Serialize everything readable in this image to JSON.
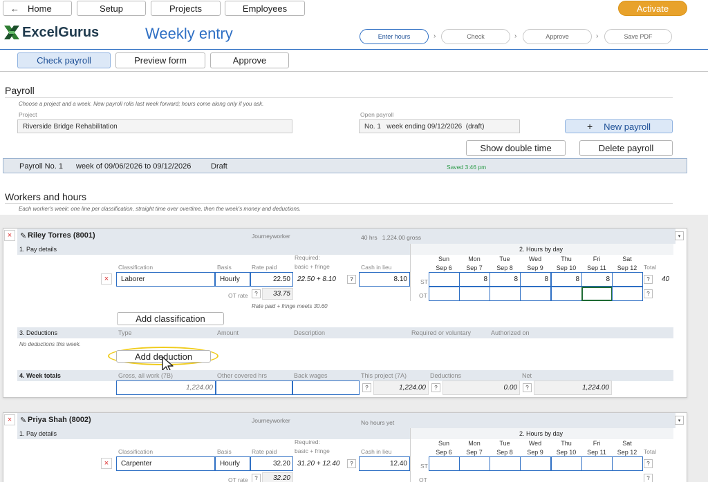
{
  "nav": {
    "home": "Home",
    "setup": "Setup",
    "projects": "Projects",
    "employees": "Employees",
    "activate": "Activate",
    "back_icon": "arrow-left-icon"
  },
  "brand": {
    "name": "ExcelGurus",
    "page_title": "Weekly entry"
  },
  "steps": [
    "Enter hours",
    "Check",
    "Approve",
    "Save PDF"
  ],
  "tabs": [
    "Check payroll",
    "Preview form",
    "Approve"
  ],
  "payroll": {
    "heading": "Payroll",
    "hint": "Choose a project and a week. New payroll rolls last week forward; hours come along only if you ask.",
    "project_label": "Project",
    "project_value": "Riverside Bridge Rehabilitation",
    "open_label": "Open payroll",
    "open_value": "No. 1   week ending 09/12/2026  (draft)",
    "new_payroll": "New payroll",
    "show_double": "Show double time",
    "delete_payroll": "Delete payroll"
  },
  "status": {
    "payroll_no": "Payroll No. 1",
    "week": "week of 09/06/2026 to 09/12/2026",
    "state": "Draft",
    "saved": "Saved 3:46 pm"
  },
  "workers_section": {
    "heading": "Workers and hours",
    "hint": "Each worker's week: one line per classification, straight time over overtime, then the week's money and deductions."
  },
  "labels": {
    "pay_details": "1. Pay details",
    "hours_by_day": "2. Hours by day",
    "deductions": "3. Deductions",
    "week_totals": "4. Week totals",
    "classification": "Classification",
    "basis": "Basis",
    "rate_paid": "Rate paid",
    "required": "Required:",
    "basic_fringe": "basic + fringe",
    "cash_in_lieu": "Cash in lieu",
    "st": "ST",
    "ot": "OT",
    "total": "Total",
    "ot_rate": "OT rate",
    "q": "?",
    "add_classification": "Add classification",
    "add_deduction": "Add deduction",
    "type": "Type",
    "amount": "Amount",
    "description": "Description",
    "req_voluntary": "Required or voluntary",
    "authorized_on": "Authorized on",
    "no_deductions": "No deductions this week.",
    "gross_all": "Gross, all work (7B)",
    "other_hrs": "Other covered hrs",
    "back_wages": "Back wages",
    "this_project": "This project (7A)",
    "deductions_col": "Deductions",
    "net": "Net"
  },
  "days": [
    {
      "d": "Sun",
      "date": "Sep 6"
    },
    {
      "d": "Mon",
      "date": "Sep 7"
    },
    {
      "d": "Tue",
      "date": "Sep 8"
    },
    {
      "d": "Wed",
      "date": "Sep 9"
    },
    {
      "d": "Thu",
      "date": "Sep 10"
    },
    {
      "d": "Fri",
      "date": "Sep 11"
    },
    {
      "d": "Sat",
      "date": "Sep 12"
    }
  ],
  "workers": [
    {
      "name": "Riley Torres (8001)",
      "level": "Journeyworker",
      "summary": "40 hrs   1,224.00 gross",
      "classification": "Laborer",
      "basis": "Hourly",
      "rate_paid": "22.50",
      "required": "22.50 + 8.10",
      "cash_in_lieu": "8.10",
      "ot_rate": "33.75",
      "rate_note": "Rate paid + fringe meets 30.60",
      "st_hours": [
        "",
        "8",
        "8",
        "8",
        "8",
        "8",
        ""
      ],
      "st_total": "40",
      "gross": "1,224.00",
      "this_project": "1,224.00",
      "deductions": "0.00",
      "net": "1,224.00"
    },
    {
      "name": "Priya Shah (8002)",
      "level": "Journeyworker",
      "summary": "No hours yet",
      "classification": "Carpenter",
      "basis": "Hourly",
      "rate_paid": "32.20",
      "required": "31.20 + 12.40",
      "cash_in_lieu": "12.40",
      "ot_rate": "32.20"
    }
  ]
}
